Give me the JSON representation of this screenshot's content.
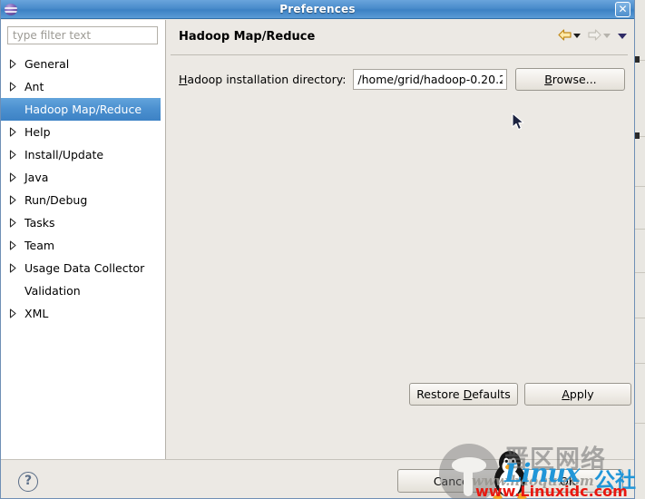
{
  "window": {
    "title": "Preferences",
    "icon": "eclipse-sphere-icon",
    "close_label": "✕"
  },
  "sidebar": {
    "filter": {
      "placeholder": "type filter text",
      "value": ""
    },
    "items": [
      {
        "label": "General",
        "expandable": true,
        "selected": false
      },
      {
        "label": "Ant",
        "expandable": true,
        "selected": false
      },
      {
        "label": "Hadoop Map/Reduce",
        "expandable": false,
        "selected": true
      },
      {
        "label": "Help",
        "expandable": true,
        "selected": false
      },
      {
        "label": "Install/Update",
        "expandable": true,
        "selected": false
      },
      {
        "label": "Java",
        "expandable": true,
        "selected": false
      },
      {
        "label": "Run/Debug",
        "expandable": true,
        "selected": false
      },
      {
        "label": "Tasks",
        "expandable": true,
        "selected": false
      },
      {
        "label": "Team",
        "expandable": true,
        "selected": false
      },
      {
        "label": "Usage Data Collector",
        "expandable": true,
        "selected": false
      },
      {
        "label": "Validation",
        "expandable": false,
        "selected": false
      },
      {
        "label": "XML",
        "expandable": true,
        "selected": false
      }
    ]
  },
  "page": {
    "title": "Hadoop Map/Reduce",
    "nav": {
      "back": "back-arrow-icon",
      "forward": "forward-arrow-icon",
      "menu": "view-menu-icon"
    },
    "form": {
      "label_prefix": "H",
      "label_rest": "adoop installation directory:",
      "directory_value": "/home/grid/hadoop-0.20.2",
      "browse_prefix": "B",
      "browse_rest": "rowse..."
    },
    "restore_prefix": "Restore ",
    "restore_mn": "D",
    "restore_rest": "efaults",
    "apply_mn": "A",
    "apply_rest": "pply"
  },
  "footer": {
    "help_label": "?",
    "cancel_label": "Cancel",
    "ok_label": "OK"
  },
  "watermark": {
    "cn_gray": "晋区网络",
    "linux": "Linux",
    "cn_blue": "公社",
    "url_gray": "www.haoqu.com",
    "url_red": "www.Linuxidc.com"
  },
  "colors": {
    "titlebar": "#4a8ccb",
    "selection": "#4a8fcf",
    "panel": "#ece9e4",
    "accent_red": "#e8170f",
    "accent_blue": "#2196d8"
  }
}
